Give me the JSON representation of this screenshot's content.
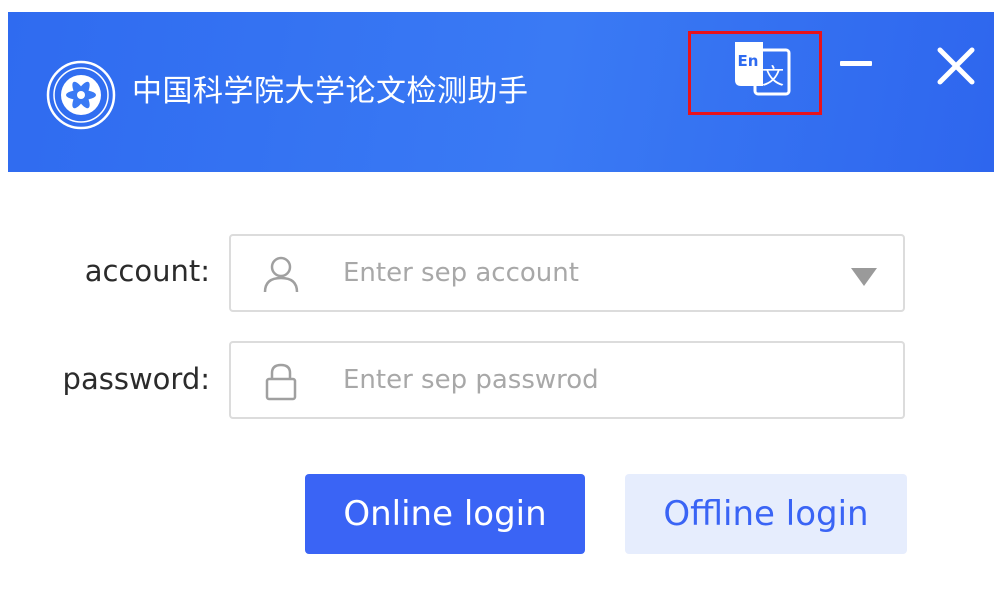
{
  "window": {
    "title": "中国科学院大学论文检测助手",
    "language_icon_text": "En",
    "language_icon_glyph": "文",
    "icons": {
      "logo": "university-seal-icon",
      "language": "translate-icon",
      "minimize": "minimize-icon",
      "close": "close-icon"
    }
  },
  "form": {
    "account": {
      "label": "account:",
      "placeholder": "Enter sep account",
      "value": "",
      "icon": "user-icon"
    },
    "password": {
      "label": "password:",
      "placeholder": "Enter sep passwrod",
      "value": "",
      "icon": "lock-icon"
    }
  },
  "buttons": {
    "online_login": "Online login",
    "offline_login": "Offline login"
  },
  "colors": {
    "titlebar": "#3a7af4",
    "primary": "#3a64f5",
    "secondary_bg": "#e6edfd",
    "highlight_border": "#e8121b"
  }
}
